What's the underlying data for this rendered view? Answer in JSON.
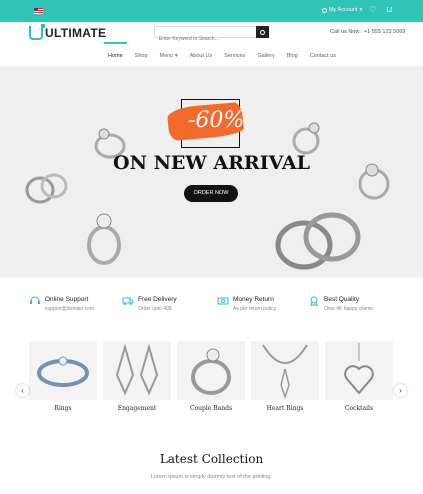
{
  "topbar": {
    "account_label": "My Account",
    "accent": "#2ec4b6"
  },
  "header": {
    "logo_text": "ULTIMATE",
    "search_placeholder": "Enter Keyword to Search...",
    "contact": "Call us Now : +1 555 123 5069"
  },
  "nav": {
    "items": [
      "Home",
      "Shop",
      "Menu",
      "About Us",
      "Services",
      "Gallery",
      "Blog",
      "Contact us"
    ],
    "active": "Home"
  },
  "hero": {
    "discount": "-60%",
    "headline": "ON NEW ARRIVAL",
    "button": "ORDER NOW",
    "brush_color": "#f26a2e"
  },
  "features": [
    {
      "title": "Online Support",
      "subtitle": "support@domain.com",
      "icon": "headset-icon"
    },
    {
      "title": "Free Delivery",
      "subtitle": "Order upto 40$",
      "icon": "truck-icon"
    },
    {
      "title": "Money Return",
      "subtitle": "As per return policy",
      "icon": "money-icon"
    },
    {
      "title": "Best Quality",
      "subtitle": "Over 4K happy clients",
      "icon": "medal-icon"
    }
  ],
  "categories": [
    {
      "label": "Rings"
    },
    {
      "label": "Engagement"
    },
    {
      "label": "Couple Bands"
    },
    {
      "label": "Heart Rings"
    },
    {
      "label": "Cocktails"
    }
  ],
  "latest": {
    "title": "Latest Collection",
    "subtitle": "Lorem Ipsum is simply dummy text of the printing."
  }
}
